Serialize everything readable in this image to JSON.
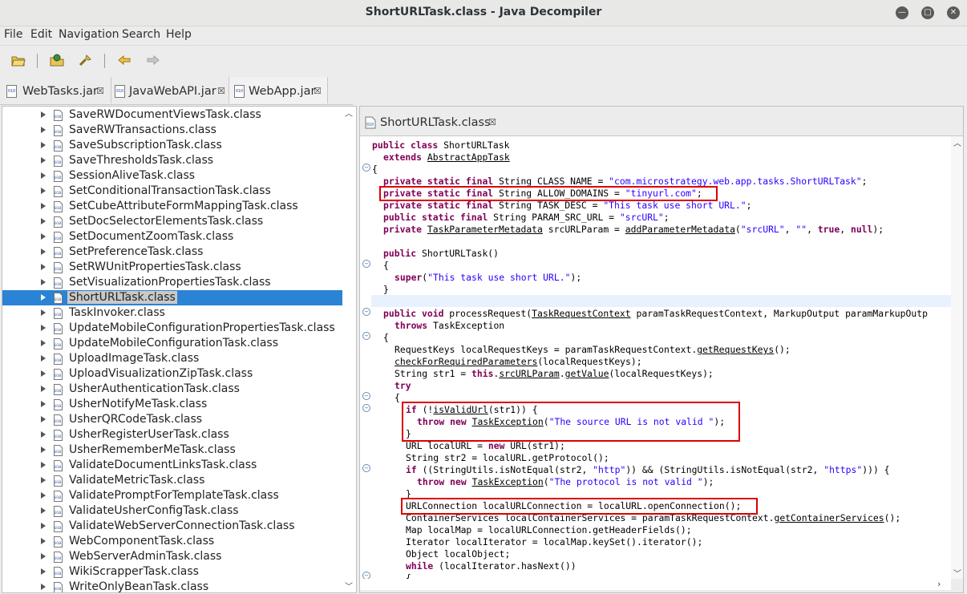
{
  "window": {
    "title": "ShortURLTask.class - Java Decompiler"
  },
  "menu": [
    "File",
    "Edit",
    "Navigation",
    "Search",
    "Help"
  ],
  "file_tabs": [
    {
      "label": "WebTasks.jar",
      "close": "☒"
    },
    {
      "label": "JavaWebAPI.jar",
      "close": "☒"
    },
    {
      "label": "WebApp.jar",
      "close": "☒"
    }
  ],
  "tree_items": [
    "SaveRWDocumentViewsTask.class",
    "SaveRWTransactions.class",
    "SaveSubscriptionTask.class",
    "SaveThresholdsTask.class",
    "SessionAliveTask.class",
    "SetConditionalTransactionTask.class",
    "SetCubeAttributeFormMappingTask.class",
    "SetDocSelectorElementsTask.class",
    "SetDocumentZoomTask.class",
    "SetPreferenceTask.class",
    "SetRWUnitPropertiesTask.class",
    "SetVisualizationPropertiesTask.class",
    "ShortURLTask.class",
    "TaskInvoker.class",
    "UpdateMobileConfigurationPropertiesTask.class",
    "UpdateMobileConfigurationTask.class",
    "UploadImageTask.class",
    "UploadVisualizationZipTask.class",
    "UsherAuthenticationTask.class",
    "UsherNotifyMeTask.class",
    "UsherQRCodeTask.class",
    "UsherRegisterUserTask.class",
    "UsherRememberMeTask.class",
    "ValidateDocumentLinksTask.class",
    "ValidateMetricTask.class",
    "ValidatePromptForTemplateTask.class",
    "ValidateUsherConfigTask.class",
    "ValidateWebServerConnectionTask.class",
    "WebComponentTask.class",
    "WebServerAdminTask.class",
    "WikiScrapperTask.class",
    "WriteOnlyBeanTask.class"
  ],
  "selected_tree_item": "ShortURLTask.class",
  "editor_tab": {
    "label": "ShortURLTask.class",
    "close": "☒"
  },
  "code": {
    "l1a": "public class",
    "l1b": " ShortURLTask",
    "l2a": "extends",
    "l2b": "AbstractAppTask",
    "l3": "{",
    "f1a": "private static final",
    "f1b": " String CLASS_NAME = ",
    "f1c": "\"com.microstrategy.web.app.tasks.ShortURLTask\"",
    "f1d": ";",
    "f2a": "private static final",
    "f2b": " String ALLOW_DOMAINS = ",
    "f2c": "\"tinyurl.com\"",
    "f2d": ";",
    "f3a": "private static final",
    "f3b": " String TASK_DESC = ",
    "f3c": "\"This task use short URL.\"",
    "f3d": ";",
    "f4a": "public static final",
    "f4b": " String PARAM_SRC_URL = ",
    "f4c": "\"srcURL\"",
    "f4d": ";",
    "f5a": "private",
    "f5b": "TaskParameterMetadata",
    "f5c": " srcURLParam = ",
    "f5d": "addParameterMetadata",
    "f5e": "(",
    "f5f": "\"srcURL\"",
    "f5g": ", ",
    "f5h": "\"\"",
    "f5i": ", ",
    "f5j": "true",
    "f5k": ", ",
    "f5l": "null",
    "f5m": ");",
    "c1a": "public",
    "c1b": " ShortURLTask()",
    "c2": "{",
    "c3a": "super",
    "c3b": "(",
    "c3c": "\"This task use short URL.\"",
    "c3d": ");",
    "c4": "}",
    "p1a": "public void",
    "p1b": " processRequest(",
    "p1c": "TaskRequestContext",
    "p1d": " paramTaskRequestContext, MarkupOutput paramMarkupOutp",
    "p2a": "throws",
    "p2b": " TaskException",
    "p3": "{",
    "p4a": "RequestKeys localRequestKeys = paramTaskRequestContext.",
    "p4b": "getRequestKeys",
    "p4c": "();",
    "p5a": "checkForRequiredParameters",
    "p5b": "(localRequestKeys);",
    "p6a": "String str1 = ",
    "p6b": "this",
    "p6c": ".",
    "p6d": "srcURLParam",
    "p6e": ".",
    "p6f": "getValue",
    "p6g": "(localRequestKeys);",
    "p7": "try",
    "p8": "{",
    "i1a": "if",
    "i1b": " (!",
    "i1c": "isValidUrl",
    "i1d": "(str1)) {",
    "i2a": "throw new",
    "i2b": "TaskException",
    "i2c": "(",
    "i2d": "\"The source URL is not valid \"",
    "i2e": ");",
    "i3": "}",
    "u1a": "URL localURL = ",
    "u1b": "new",
    "u1c": " URL(str1);",
    "u2": "String str2 = localURL.getProtocol();",
    "u3a": "if",
    "u3b": " ((StringUtils.isNotEqual(str2, ",
    "u3c": "\"http\"",
    "u3d": ")) && (StringUtils.isNotEqual(str2, ",
    "u3e": "\"https\"",
    "u3f": "))) {",
    "u4a": "throw new",
    "u4b": "TaskException",
    "u4c": "(",
    "u4d": "\"The protocol is not valid \"",
    "u4e": ");",
    "u5": "}",
    "u6": "URLConnection localURLConnection = localURL.openConnection();",
    "u7a": "ContainerServices localContainerServices = paramTaskRequestContext.",
    "u7b": "getContainerServices",
    "u7c": "();",
    "u8": "Map localMap = localURLConnection.getHeaderFields();",
    "u9": "Iterator localIterator = localMap.keySet().iterator();",
    "u10": "Object localObject;",
    "u11a": "while",
    "u11b": " (localIterator.hasNext())",
    "u12": "{"
  }
}
